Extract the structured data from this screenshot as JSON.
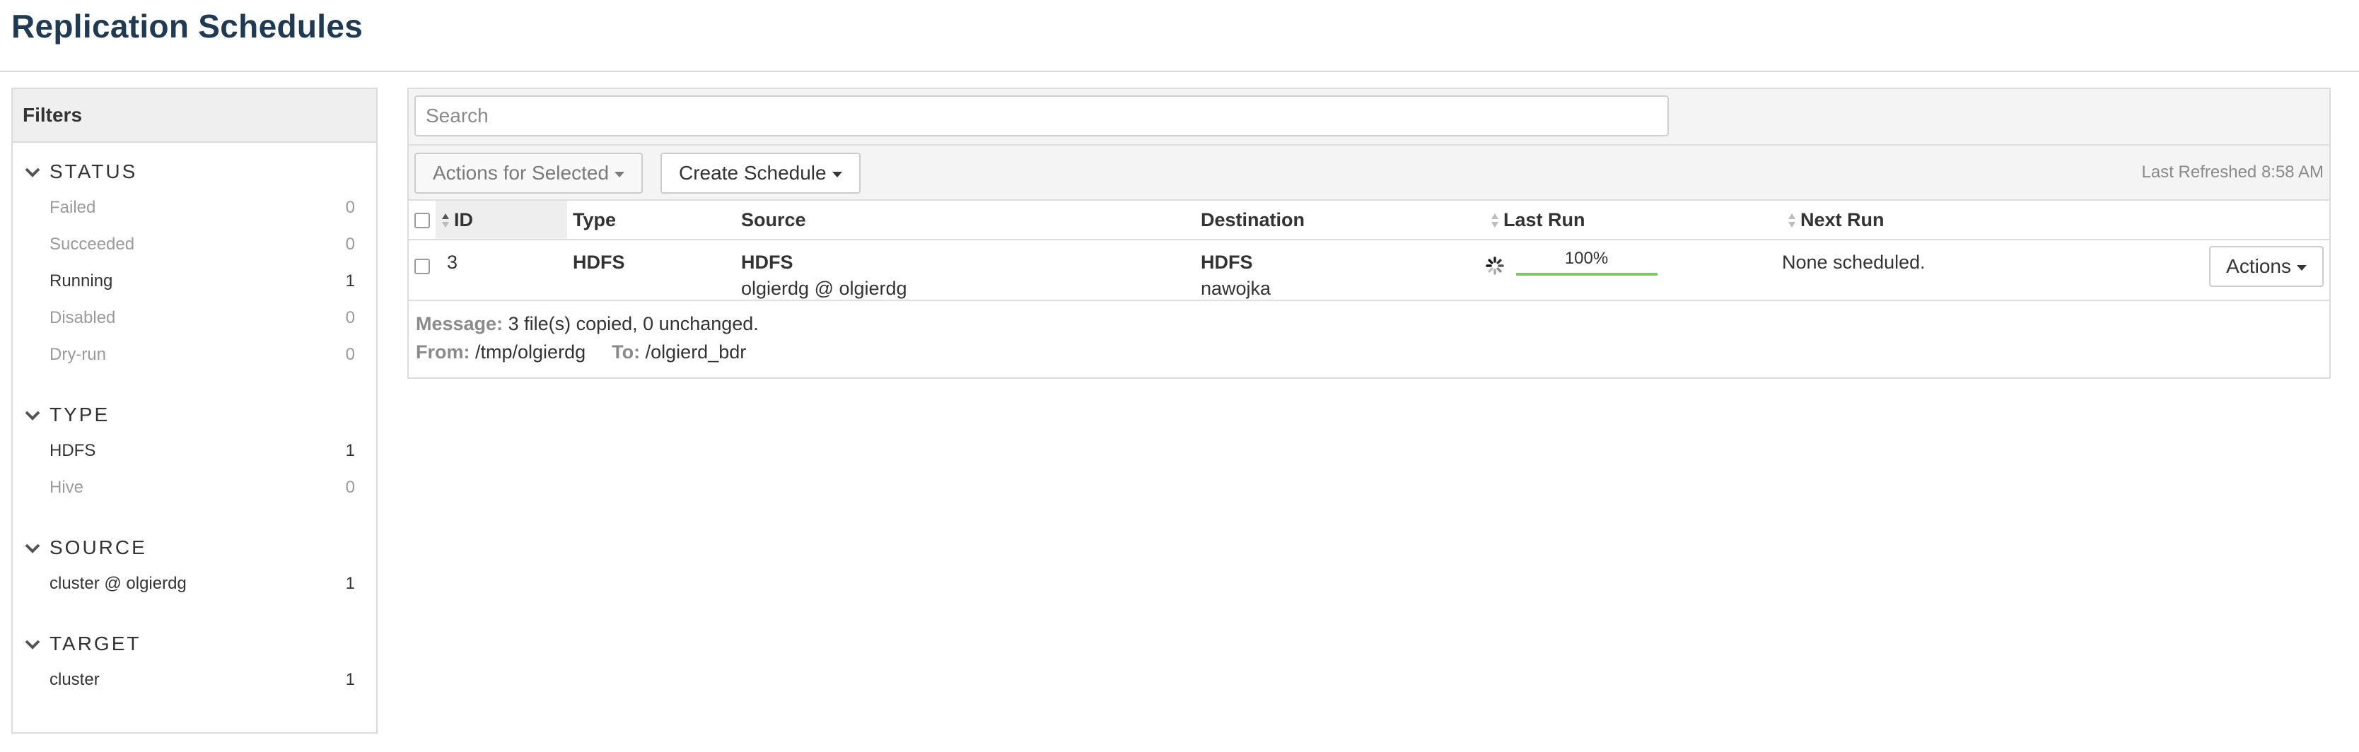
{
  "page_title": "Replication Schedules",
  "sidebar": {
    "title": "Filters",
    "groups": [
      {
        "title": "STATUS",
        "items": [
          {
            "label": "Failed",
            "count": "0"
          },
          {
            "label": "Succeeded",
            "count": "0"
          },
          {
            "label": "Running",
            "count": "1"
          },
          {
            "label": "Disabled",
            "count": "0"
          },
          {
            "label": "Dry-run",
            "count": "0"
          }
        ]
      },
      {
        "title": "TYPE",
        "items": [
          {
            "label": "HDFS",
            "count": "1"
          },
          {
            "label": "Hive",
            "count": "0"
          }
        ]
      },
      {
        "title": "SOURCE",
        "items": [
          {
            "label": "cluster @ olgierdg",
            "count": "1"
          }
        ]
      },
      {
        "title": "TARGET",
        "items": [
          {
            "label": "cluster",
            "count": "1"
          }
        ]
      }
    ]
  },
  "search": {
    "placeholder": "Search",
    "value": ""
  },
  "toolbar": {
    "actions_selected_label": "Actions for Selected",
    "create_schedule_label": "Create Schedule",
    "last_refreshed": "Last Refreshed 8:58 AM"
  },
  "table": {
    "headers": {
      "id": "ID",
      "type": "Type",
      "source": "Source",
      "destination": "Destination",
      "last_run": "Last Run",
      "next_run": "Next Run"
    },
    "rows": [
      {
        "id": "3",
        "type": "HDFS",
        "source_type": "HDFS",
        "source_detail": "olgierdg @ olgierdg",
        "destination_type": "HDFS",
        "destination_detail": "nawojka",
        "last_run_progress": 1.0,
        "last_run_label": "100%",
        "next_run": "None scheduled.",
        "actions_label": "Actions"
      }
    ]
  },
  "message": {
    "message_label": "Message:",
    "message_text": "3 file(s) copied, 0 unchanged.",
    "from_label": "From:",
    "from_value": "/tmp/olgierdg",
    "to_label": "To:",
    "to_value": "/olgierd_bdr"
  },
  "colors": {
    "title": "#1f3a52",
    "progress": "#7fc860",
    "muted": "#9a9a9a"
  },
  "icons": [
    "chevron-down-icon",
    "sort-icon",
    "spinner-icon",
    "caret-down-icon",
    "checkbox"
  ]
}
